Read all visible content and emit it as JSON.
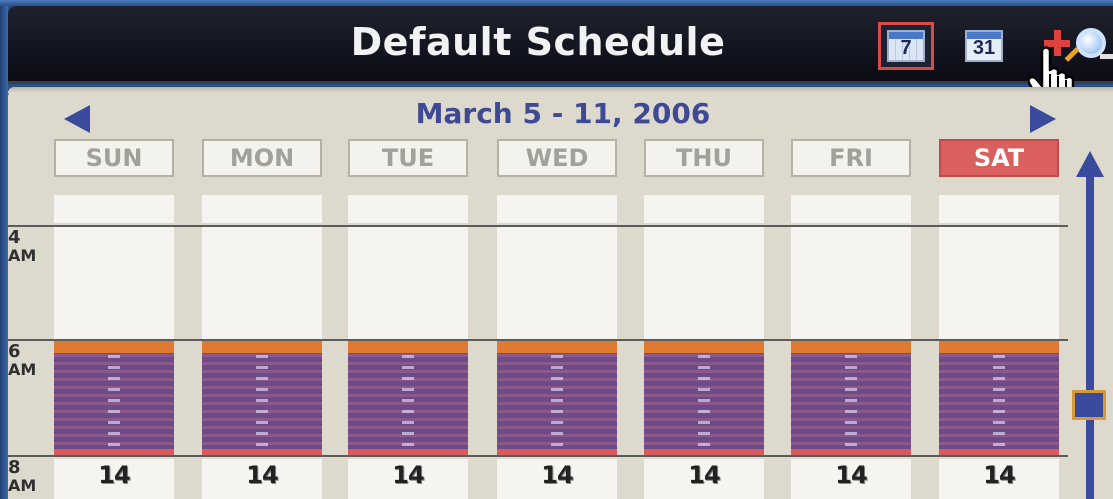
{
  "title": "Default Schedule",
  "toolbar": {
    "week_view_day": "7",
    "month_view_day": "31",
    "zoom_in_icon": "zoom-in-icon",
    "zoom_out_icon": "zoom-out-icon"
  },
  "navigation": {
    "week_range": "March 5 - 11, 2006",
    "prev_icon": "left-triangle-icon",
    "next_icon": "right-triangle-icon"
  },
  "days": [
    {
      "label": "SUN",
      "active": false,
      "cell_value": "14"
    },
    {
      "label": "MON",
      "active": false,
      "cell_value": "14"
    },
    {
      "label": "TUE",
      "active": false,
      "cell_value": "14"
    },
    {
      "label": "WED",
      "active": false,
      "cell_value": "14"
    },
    {
      "label": "THU",
      "active": false,
      "cell_value": "14"
    },
    {
      "label": "FRI",
      "active": false,
      "cell_value": "14"
    },
    {
      "label": "SAT",
      "active": true,
      "cell_value": "14"
    }
  ],
  "time_labels": [
    {
      "hour": "4",
      "period": "AM"
    },
    {
      "hour": "6",
      "period": "AM"
    },
    {
      "hour": "8",
      "period": "AM"
    }
  ],
  "colors": {
    "accent": "#3a4a9c",
    "selected_day": "#d9605f",
    "event_orange": "#e07a30",
    "event_purple": "#6e4a86"
  }
}
